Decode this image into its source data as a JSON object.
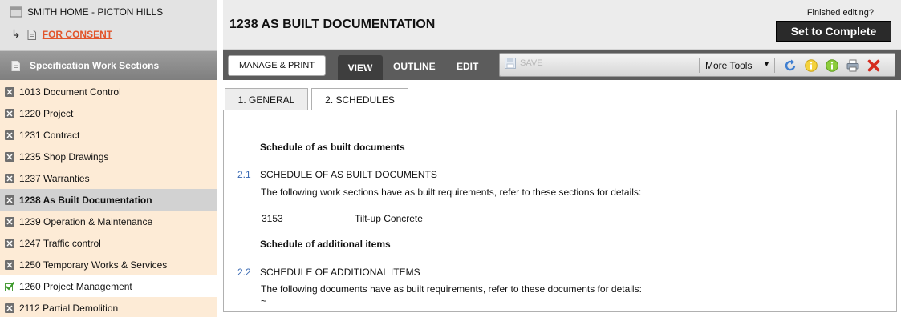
{
  "project": {
    "title": "SMITH HOME - PICTON HILLS",
    "status_link": "FOR CONSENT"
  },
  "sidebar": {
    "header": "Specification Work Sections",
    "items": [
      {
        "label": "1013 Document Control",
        "state": "normal"
      },
      {
        "label": "1220 Project",
        "state": "normal"
      },
      {
        "label": "1231 Contract",
        "state": "normal"
      },
      {
        "label": "1235 Shop Drawings",
        "state": "normal"
      },
      {
        "label": "1237 Warranties",
        "state": "normal"
      },
      {
        "label": "1238 As Built Documentation",
        "state": "active"
      },
      {
        "label": "1239 Operation & Maintenance",
        "state": "normal"
      },
      {
        "label": "1247 Traffic control",
        "state": "normal"
      },
      {
        "label": "1250 Temporary Works & Services",
        "state": "normal"
      },
      {
        "label": "1260 Project Management",
        "state": "done"
      },
      {
        "label": "2112 Partial Demolition",
        "state": "normal"
      }
    ]
  },
  "header": {
    "title": "1238 AS BUILT DOCUMENTATION",
    "finished_label": "Finished editing?",
    "complete_button": "Set to Complete"
  },
  "toolbar": {
    "manage_print": "MANAGE & PRINT",
    "tabs": [
      "VIEW",
      "OUTLINE",
      "EDIT"
    ],
    "active_tab": "VIEW",
    "save": "SAVE",
    "more_tools": "More Tools",
    "icons": [
      "refresh-icon",
      "info-yellow-icon",
      "info-green-icon",
      "print-icon",
      "delete-icon"
    ]
  },
  "doc_tabs": [
    "1. GENERAL",
    "2. SCHEDULES"
  ],
  "active_doc_tab": "2. SCHEDULES",
  "content": {
    "heading1": "Schedule of as built documents",
    "s1_num": "2.1",
    "s1_title": "SCHEDULE OF AS BUILT DOCUMENTS",
    "s1_desc": "The following work sections have as built requirements, refer to these sections for details:",
    "s1_row_code": "3153",
    "s1_row_name": "Tilt-up Concrete",
    "heading2": "Schedule of additional items",
    "s2_num": "2.2",
    "s2_title": "SCHEDULE OF ADDITIONAL ITEMS",
    "s2_desc": "The following documents have as built requirements, refer to these documents for details:",
    "s2_tilde": "~"
  },
  "colors": {
    "accent_link": "#e2552b",
    "sidebar_bg": "#fdebd6",
    "toolbar_bg": "#5c5c5c",
    "section_number": "#3a6ab3"
  }
}
